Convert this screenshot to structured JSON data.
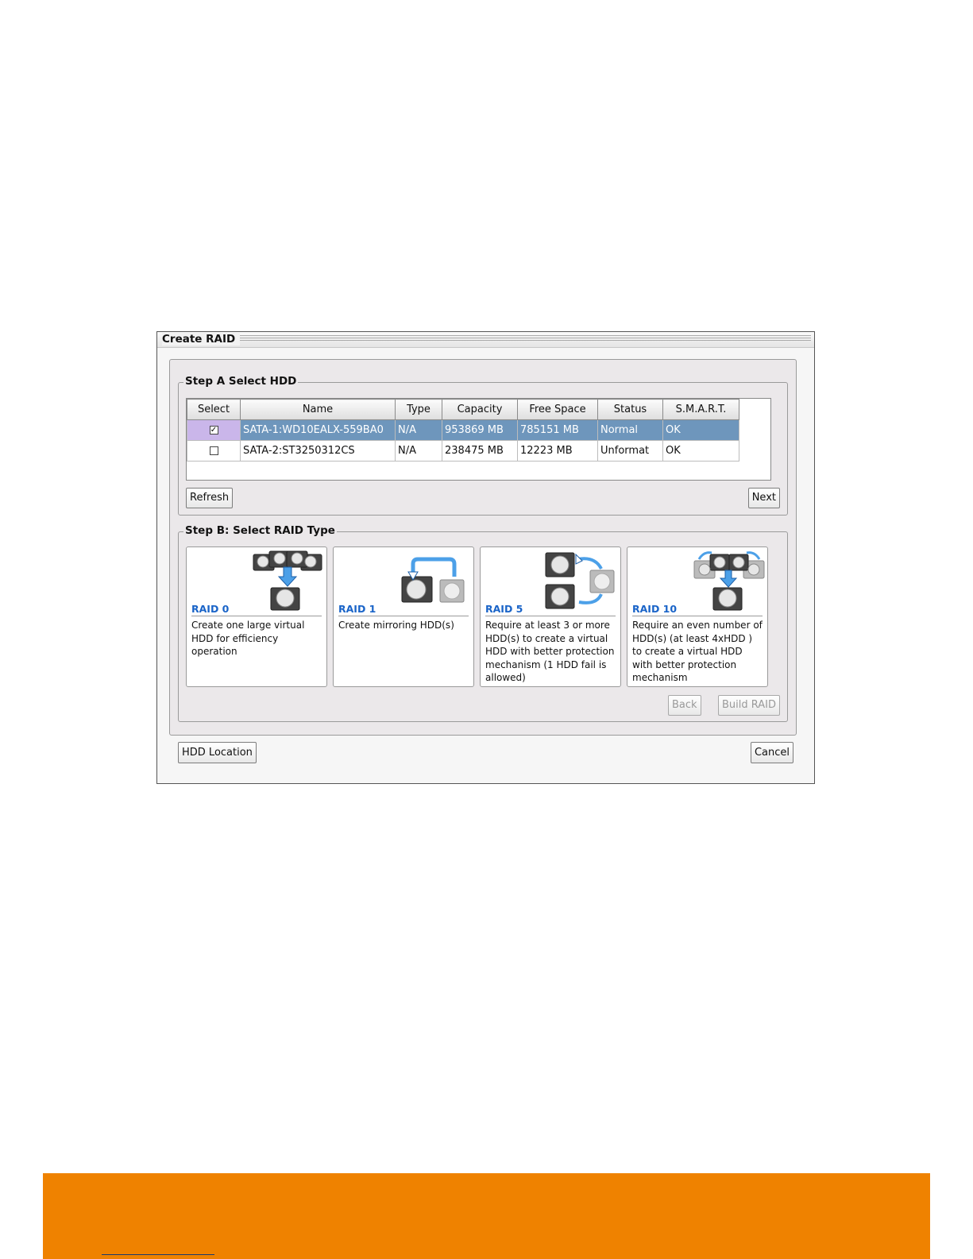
{
  "dialog": {
    "title": "Create RAID",
    "step_a": {
      "legend": "Step A Select HDD",
      "columns": [
        "Select",
        "Name",
        "Type",
        "Capacity",
        "Free Space",
        "Status",
        "S.M.A.R.T."
      ],
      "rows": [
        {
          "checked": true,
          "name": "SATA-1:WD10EALX-559BA0",
          "type": "N/A",
          "capacity": "953869 MB",
          "free_space": "785151 MB",
          "status": "Normal",
          "smart": "OK"
        },
        {
          "checked": false,
          "name": "SATA-2:ST3250312CS",
          "type": "N/A",
          "capacity": "238475 MB",
          "free_space": "12223 MB",
          "status": "Unformat",
          "smart": "OK"
        }
      ],
      "refresh_label": "Refresh",
      "next_label": "Next"
    },
    "step_b": {
      "legend": "Step B: Select RAID Type",
      "cards": [
        {
          "title": "RAID 0",
          "description": "Create one large virtual HDD for efficiency operation",
          "icon": "raid0-drives-icon"
        },
        {
          "title": "RAID 1",
          "description": "Create mirroring HDD(s)",
          "icon": "raid1-mirror-icon"
        },
        {
          "title": "RAID 5",
          "description": "Require at least 3 or more HDD(s)  to create a virtual HDD with better protection mechanism (1 HDD fail is allowed)",
          "icon": "raid5-drives-icon"
        },
        {
          "title": "RAID 10",
          "description": "Require an even number of HDD(s) (at least 4xHDD ) to create a virtual HDD with better protection mechanism",
          "icon": "raid10-drives-icon"
        }
      ],
      "back_label": "Back",
      "build_label": "Build RAID"
    },
    "hdd_location_label": "HDD Location",
    "cancel_label": "Cancel"
  },
  "colors": {
    "selected_row": "#6e96bc",
    "selected_checkbox_cell": "#cab6ea",
    "raid_title": "#1a64c8",
    "footer_band": "#ef8200"
  }
}
